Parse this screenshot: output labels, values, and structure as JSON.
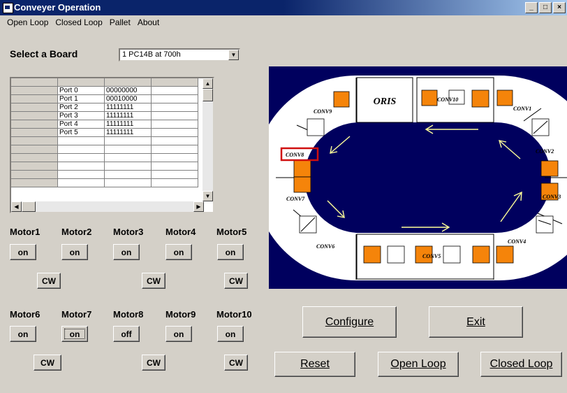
{
  "window": {
    "title": "Conveyer Operation",
    "controls": [
      "minimize-icon",
      "maximize-icon",
      "close-icon"
    ]
  },
  "menu": [
    "Open Loop",
    "Closed Loop",
    "Pallet",
    "About"
  ],
  "board": {
    "label": "Select a Board",
    "selected": "1 PC14B at 700h"
  },
  "ports": [
    {
      "name": "Port 0",
      "value": "00000000"
    },
    {
      "name": "Port 1",
      "value": "00010000"
    },
    {
      "name": "Port 2",
      "value": "11111111"
    },
    {
      "name": "Port 3",
      "value": "11111111"
    },
    {
      "name": "Port 4",
      "value": "11111111"
    },
    {
      "name": "Port 5",
      "value": "11111111"
    }
  ],
  "motors": [
    {
      "label": "Motor1",
      "state": "on"
    },
    {
      "label": "Motor2",
      "state": "on"
    },
    {
      "label": "Motor3",
      "state": "on"
    },
    {
      "label": "Motor4",
      "state": "on"
    },
    {
      "label": "Motor5",
      "state": "on"
    },
    {
      "label": "Motor6",
      "state": "on"
    },
    {
      "label": "Motor7",
      "state": "on"
    },
    {
      "label": "Motor8",
      "state": "off"
    },
    {
      "label": "Motor9",
      "state": "on"
    },
    {
      "label": "Motor10",
      "state": "on"
    }
  ],
  "direction_label": "CW",
  "buttons": {
    "configure": "Configure",
    "exit": "Exit",
    "reset": "Reset",
    "open_loop": "Open Loop",
    "closed_loop": "Closed Loop"
  },
  "diagram": {
    "oris": "ORIS",
    "labels": {
      "conv1": "CONV1",
      "conv2": "CONV2",
      "conv3": "CONV3",
      "conv4": "CONV4",
      "conv5": "CONV5",
      "conv6": "CONV6",
      "conv7": "CONV7",
      "conv8": "CONV8",
      "conv9": "CONV9",
      "conv10": "CONV10"
    },
    "colors": {
      "background": "#00005e",
      "track": "#ffffff",
      "pallet": "#f5840a",
      "arrow": "#ffff99",
      "highlight": "#d01010"
    }
  }
}
